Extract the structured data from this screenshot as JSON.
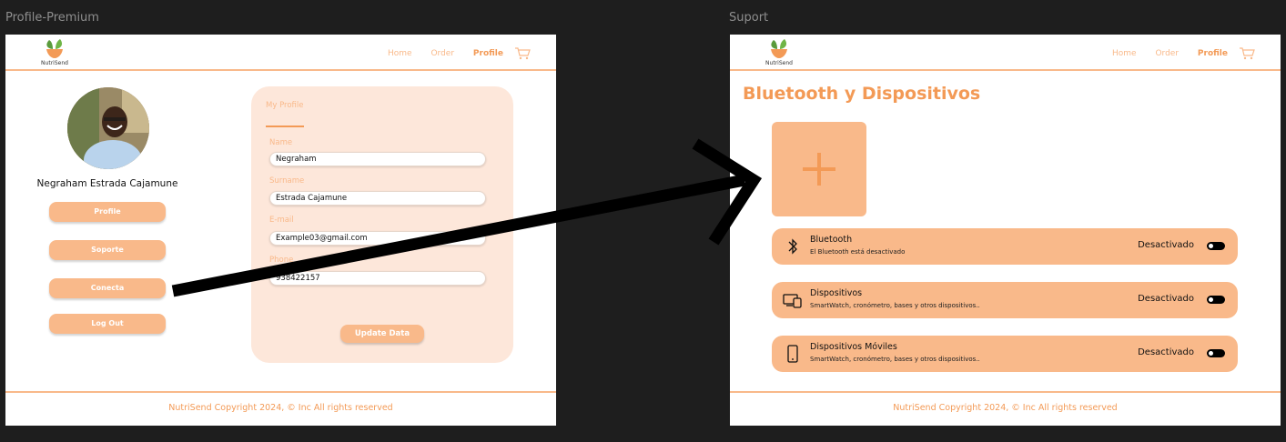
{
  "frames": {
    "profile": {
      "label": "Profile-Premium"
    },
    "support": {
      "label": "Suport"
    }
  },
  "nav": {
    "logo_text": "NutriSend",
    "links": [
      "Home",
      "Order",
      "Profile"
    ],
    "active": "Profile",
    "cart_icon": "cart-icon"
  },
  "profile": {
    "user_name": "Negraham Estrada Cajamune",
    "side_buttons": [
      "Profile",
      "Soporte",
      "Conecta",
      "Log Out"
    ],
    "card_title": "My Profile",
    "fields": [
      {
        "label": "Name",
        "value": "Negraham"
      },
      {
        "label": "Surname",
        "value": "Estrada Cajamune"
      },
      {
        "label": "E-mail",
        "value": "Example03@gmail.com"
      },
      {
        "label": "Phone",
        "value": "938422157"
      }
    ],
    "update_button": "Update Data"
  },
  "support": {
    "title": "Bluetooth y Dispositivos",
    "add_icon": "plus-icon",
    "rows": [
      {
        "icon": "bluetooth-icon",
        "title": "Bluetooth",
        "subtitle": "El Bluetooth está desactivado",
        "status": "Desactivado",
        "enabled": false
      },
      {
        "icon": "devices-icon",
        "title": "Dispositivos",
        "subtitle": "SmartWatch, cronómetro, bases y otros dispositivos..",
        "status": "Desactivado",
        "enabled": false
      },
      {
        "icon": "mobile-icon",
        "title": "Dispositivos Móviles",
        "subtitle": "SmartWatch, cronómetro, bases y otros dispositivos..",
        "status": "Desactivado",
        "enabled": false
      }
    ]
  },
  "footer": {
    "text": "NutriSend Copyright 2024, © Inc All rights reserved"
  },
  "colors": {
    "accent": "#f39a56",
    "accent_light": "#f9b98a",
    "card_bg": "#fde7da",
    "canvas": "#1e1e1e"
  }
}
